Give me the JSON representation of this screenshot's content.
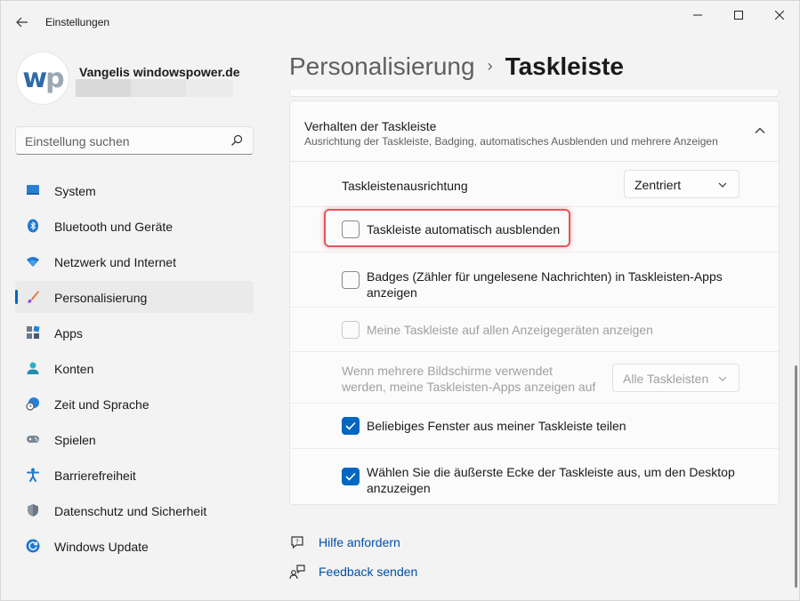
{
  "window": {
    "title": "Einstellungen",
    "controls": {
      "minimize": "minimize-icon",
      "maximize": "maximize-icon",
      "close": "close-icon"
    }
  },
  "profile": {
    "name": "Vangelis windowspower.de",
    "avatar_text_a": "w",
    "avatar_text_b": "p"
  },
  "search": {
    "placeholder": "Einstellung suchen"
  },
  "sidebar": {
    "items": [
      {
        "label": "System",
        "icon": "monitor-icon",
        "active": false
      },
      {
        "label": "Bluetooth und Geräte",
        "icon": "bluetooth-icon",
        "active": false
      },
      {
        "label": "Netzwerk und Internet",
        "icon": "wifi-icon",
        "active": false
      },
      {
        "label": "Personalisierung",
        "icon": "brush-icon",
        "active": true
      },
      {
        "label": "Apps",
        "icon": "apps-icon",
        "active": false
      },
      {
        "label": "Konten",
        "icon": "person-icon",
        "active": false
      },
      {
        "label": "Zeit und Sprache",
        "icon": "clock-globe-icon",
        "active": false
      },
      {
        "label": "Spielen",
        "icon": "gamepad-icon",
        "active": false
      },
      {
        "label": "Barrierefreiheit",
        "icon": "accessibility-icon",
        "active": false
      },
      {
        "label": "Datenschutz und Sicherheit",
        "icon": "shield-icon",
        "active": false
      },
      {
        "label": "Windows Update",
        "icon": "update-icon",
        "active": false
      }
    ]
  },
  "breadcrumb": {
    "parent": "Personalisierung",
    "separator": "›",
    "current": "Taskleiste"
  },
  "section": {
    "title": "Verhalten der Taskleiste",
    "subtitle": "Ausrichtung der Taskleiste, Badging, automatisches Ausblenden und mehrere Anzeigen",
    "expanded": true
  },
  "settings": {
    "alignment": {
      "label": "Taskleistenausrichtung",
      "value": "Zentriert"
    },
    "autohide": {
      "label": "Taskleiste automatisch ausblenden",
      "checked": false
    },
    "badges": {
      "label_line1": "Badges (Zähler für ungelesene Nachrichten) in Taskleisten-Apps",
      "label_line2": "anzeigen",
      "checked": false
    },
    "all_displays": {
      "label": "Meine Taskleiste auf allen Anzeigegeräten anzeigen",
      "checked": false,
      "disabled": true
    },
    "multi_monitor": {
      "label_line1": "Wenn mehrere Bildschirme verwendet",
      "label_line2": "werden, meine Taskleisten-Apps anzeigen auf",
      "value": "Alle Taskleisten",
      "disabled": true
    },
    "share_window": {
      "label": "Beliebiges Fenster aus meiner Taskleiste teilen",
      "checked": true
    },
    "far_corner": {
      "label_line1": "Wählen Sie die äußerste Ecke der Taskleiste aus, um den Desktop",
      "label_line2": "anzuzeigen",
      "checked": true
    }
  },
  "links": {
    "help": "Hilfe anfordern",
    "feedback": "Feedback senden"
  },
  "colors": {
    "accent": "#0067c0",
    "highlight": "#e0575b",
    "link": "#0050a8"
  }
}
